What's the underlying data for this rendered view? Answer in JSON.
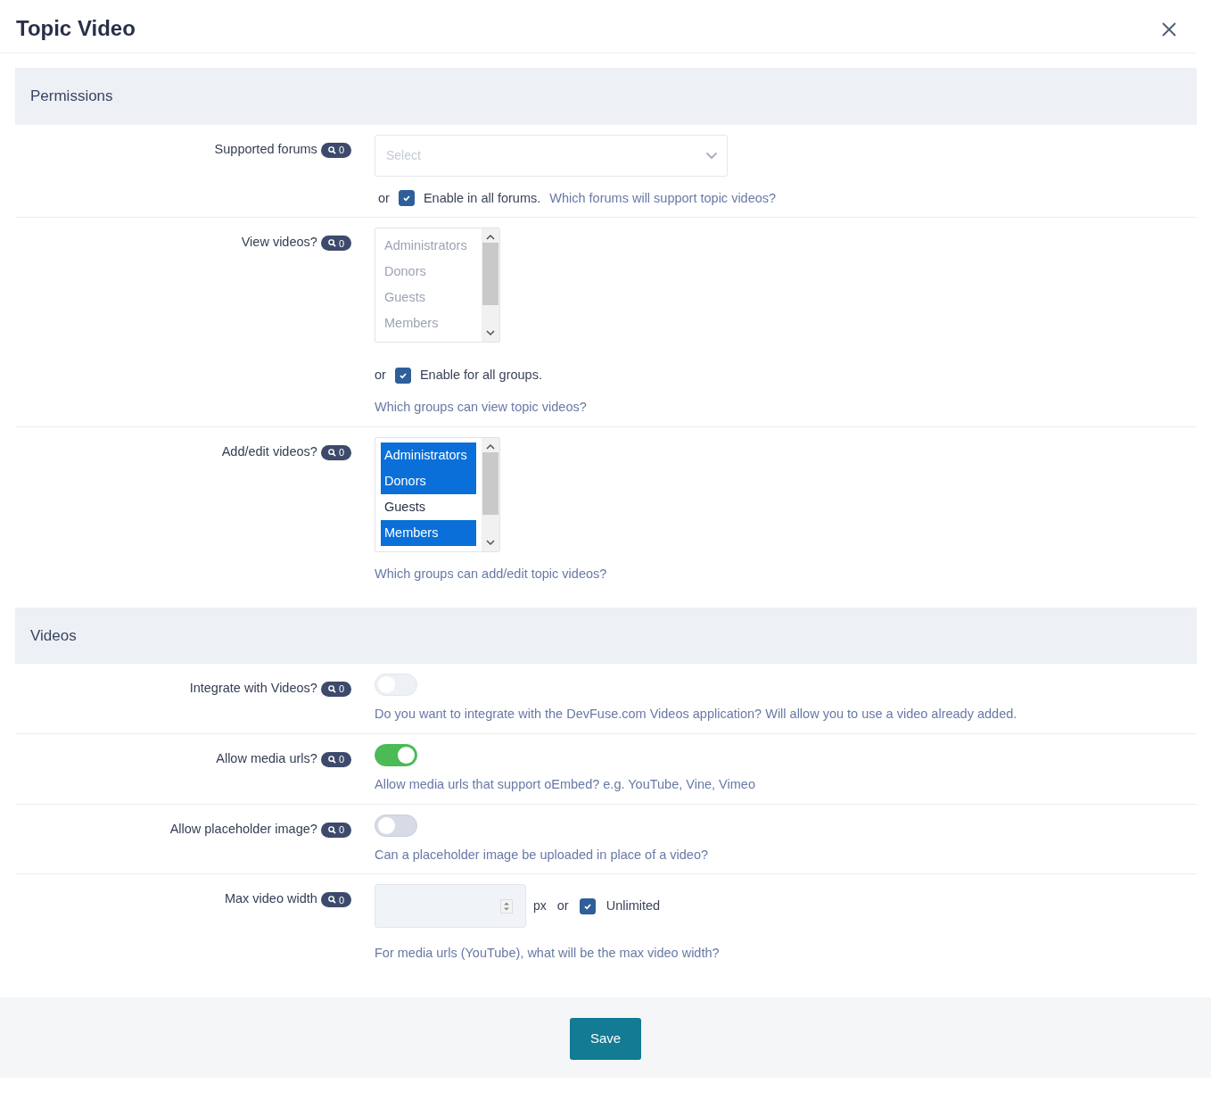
{
  "dialog": {
    "title": "Topic Video"
  },
  "sections": [
    {
      "title": "Permissions",
      "rows": [
        {
          "kind": "select",
          "label": "Supported forums",
          "badge": "0",
          "placeholder": "Select",
          "or_text": "or",
          "checkbox": {
            "label": "Enable in all forums.",
            "checked": true
          },
          "help": "Which forums will support topic videos?"
        },
        {
          "kind": "listbox",
          "label": "View videos?",
          "badge": "0",
          "disabled": true,
          "options": [
            {
              "label": "Administrators",
              "selected": false
            },
            {
              "label": "Donors",
              "selected": false
            },
            {
              "label": "Guests",
              "selected": false
            },
            {
              "label": "Members",
              "selected": false
            }
          ],
          "or_text": "or",
          "checkbox": {
            "label": "Enable for all groups.",
            "checked": true
          },
          "help": "Which groups can view topic videos?"
        },
        {
          "kind": "listbox",
          "label": "Add/edit videos?",
          "badge": "0",
          "disabled": false,
          "options": [
            {
              "label": "Administrators",
              "selected": true
            },
            {
              "label": "Donors",
              "selected": true
            },
            {
              "label": "Guests",
              "selected": false
            },
            {
              "label": "Members",
              "selected": true
            }
          ],
          "help": "Which groups can add/edit topic videos?"
        }
      ]
    },
    {
      "title": "Videos",
      "rows": [
        {
          "kind": "toggle",
          "label": "Integrate with Videos?",
          "badge": "0",
          "on": false,
          "disabled": true,
          "help": "Do you want to integrate with the DevFuse.com Videos application? Will allow you to use a video already added."
        },
        {
          "kind": "toggle",
          "label": "Allow media urls?",
          "badge": "0",
          "on": true,
          "disabled": false,
          "help": "Allow media urls that support oEmbed? e.g. YouTube, Vine, Vimeo"
        },
        {
          "kind": "toggle",
          "label": "Allow placeholder image?",
          "badge": "0",
          "on": false,
          "disabled": false,
          "help": "Can a placeholder image be uploaded in place of a video?"
        },
        {
          "kind": "number",
          "label": "Max video width",
          "badge": "0",
          "unit": "px",
          "or_text": "or",
          "checkbox": {
            "label": "Unlimited",
            "checked": true
          },
          "help": "For media urls (YouTube), what will be the max video width?"
        }
      ]
    }
  ],
  "footer": {
    "save_button": "Save"
  }
}
